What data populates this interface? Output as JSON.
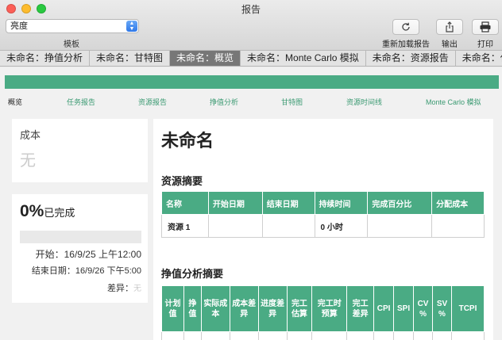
{
  "window": {
    "title": "报告"
  },
  "toolbar": {
    "theme_value": "亮度",
    "theme_label": "模板",
    "reload_label": "重新加载报告",
    "export_label": "输出",
    "print_label": "打印"
  },
  "tabs": [
    {
      "label": "未命名：挣值分析"
    },
    {
      "label": "未命名：甘特图"
    },
    {
      "label": "未命名：概览",
      "active": true
    },
    {
      "label": "未命名：Monte Carlo 模拟"
    },
    {
      "label": "未命名：资源报告"
    },
    {
      "label": "未命名：任务报"
    }
  ],
  "report_nav": [
    "概览",
    "任务报告",
    "资源报告",
    "挣值分析",
    "甘特图",
    "资源时间线",
    "Monte Carlo 模拟"
  ],
  "cost_card": {
    "title": "成本",
    "value": "无"
  },
  "completion_card": {
    "percent_text": "0%",
    "percent_suffix": "已完成",
    "progress": 0,
    "start": "开始：16/9/25 上午12:00",
    "end": "结束日期：16/9/26 下午5:00",
    "variance_label": "差异：",
    "variance_value": "无"
  },
  "main": {
    "project_title": "未命名",
    "resource_summary_title": "资源摘要",
    "resource_table": {
      "headers": [
        "名称",
        "开始日期",
        "结束日期",
        "持续时间",
        "完成百分比",
        "分配成本"
      ],
      "rows": [
        [
          "资源 1",
          "",
          "",
          "0 小时",
          "",
          ""
        ]
      ]
    },
    "ev_summary_title": "挣值分析摘要",
    "ev_table": {
      "headers": [
        "计划值",
        "挣值",
        "实际成本",
        "成本差异",
        "进度差异",
        "完工估算",
        "完工时预算",
        "完工差异",
        "CPI",
        "SPI",
        "CV %",
        "SV %",
        "TCPI"
      ]
    }
  },
  "colors": {
    "accent": "#4aab84",
    "active_tab": "#777777"
  }
}
